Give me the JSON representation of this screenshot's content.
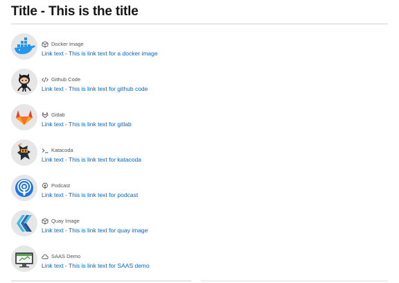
{
  "page": {
    "title": "Title - This is the title"
  },
  "items": [
    {
      "icon": "docker-whale-icon",
      "type_icon": "cube-icon",
      "type": "Docker Image",
      "link": "Link text - This is link text for a docker image"
    },
    {
      "icon": "github-octocat-icon",
      "type_icon": "code-icon",
      "type": "Github Code",
      "link": "Link text - This is link text for github code"
    },
    {
      "icon": "gitlab-fox-icon",
      "type_icon": "gitlab-small-icon",
      "type": "Gitlab",
      "link": "Link text - This is link text for gitlab"
    },
    {
      "icon": "katacoda-icon",
      "type_icon": "terminal-icon",
      "type": "Katacoda",
      "link": "Link text - This is link text for katacoda"
    },
    {
      "icon": "podcast-icon",
      "type_icon": "podcast-small-icon",
      "type": "Podcast",
      "link": "Link text - This is link text for podcast"
    },
    {
      "icon": "quay-icon",
      "type_icon": "cube-icon",
      "type": "Quay Image",
      "link": "Link text - This is link text for quay image"
    },
    {
      "icon": "saas-demo-icon",
      "type_icon": "cloud-icon",
      "type": "SAAS Demo",
      "link": "Link text - This is link text for SAAS demo"
    }
  ],
  "colors": {
    "link": "#0066cc",
    "title": "#151515",
    "meta": "#4f5255",
    "avatar_bg": "#e6e6e6"
  }
}
